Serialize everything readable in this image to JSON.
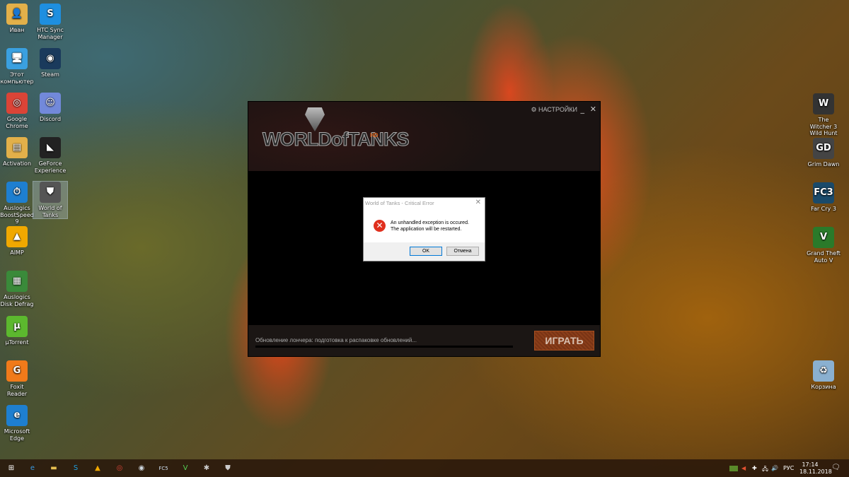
{
  "desktop": {
    "left_icons": [
      {
        "label": "Иван",
        "glyph": "👤",
        "color": "#e2b04a"
      },
      {
        "label": "HTC Sync Manager",
        "glyph": "S",
        "color": "#1e8fe0"
      },
      {
        "label": "Этот компьютер",
        "glyph": "🖥",
        "color": "#3aa0e0"
      },
      {
        "label": "Steam",
        "glyph": "◉",
        "color": "#1a3a5c"
      },
      {
        "label": "Google Chrome",
        "glyph": "◎",
        "color": "#db4437"
      },
      {
        "label": "Discord",
        "glyph": "☺",
        "color": "#7289da"
      },
      {
        "label": "Activation",
        "glyph": "▤",
        "color": "#e2b04a"
      },
      {
        "label": "GeForce Experience",
        "glyph": "◣",
        "color": "#222"
      },
      {
        "label": "Auslogics BoostSpeed 9",
        "glyph": "⏱",
        "color": "#1e7fd0"
      },
      {
        "label": "World of Tanks",
        "glyph": "⛊",
        "color": "#555"
      },
      {
        "label": "AIMP",
        "glyph": "▲",
        "color": "#f0a800"
      },
      {
        "label": "Auslogics Disk Defrag",
        "glyph": "▦",
        "color": "#3a8a3a"
      },
      {
        "label": "µTorrent",
        "glyph": "µ",
        "color": "#5cb82e"
      },
      {
        "label": "Foxit Reader",
        "glyph": "G",
        "color": "#f07a1a"
      },
      {
        "label": "Microsoft Edge",
        "glyph": "e",
        "color": "#1e7fd0"
      }
    ],
    "right_icons": [
      {
        "label": "The Witcher 3 Wild Hunt",
        "glyph": "W",
        "color": "#333"
      },
      {
        "label": "Grim Dawn",
        "glyph": "GD",
        "color": "#444"
      },
      {
        "label": "Far Cry 3",
        "glyph": "FC3",
        "color": "#1a4a6a"
      },
      {
        "label": "Grand Theft Auto V",
        "glyph": "V",
        "color": "#2a7a2a"
      },
      {
        "label": "Корзина",
        "glyph": "♻",
        "color": "#8ab0d0"
      }
    ]
  },
  "launcher": {
    "logo": "WORLDofTANKS",
    "hd": "HD",
    "settings": "⚙ НАСТРОЙКИ",
    "status": "Обновление лончера: подготовка к распаковке обновлений...",
    "play": "ИГРАТЬ",
    "progress": 0
  },
  "dialog": {
    "title": "World of Tanks - Critical Error",
    "line1": "An unhandled exception is occured.",
    "line2": "The application will be restarted.",
    "ok": "OK",
    "cancel": "Отмена"
  },
  "taskbar": {
    "apps": [
      {
        "name": "start",
        "glyph": "⊞",
        "color": "#fff"
      },
      {
        "name": "edge",
        "glyph": "e",
        "color": "#3a9ae0"
      },
      {
        "name": "explorer",
        "glyph": "▬",
        "color": "#e8c050"
      },
      {
        "name": "skype",
        "glyph": "S",
        "color": "#1ea0e0"
      },
      {
        "name": "aimp",
        "glyph": "▲",
        "color": "#f0a800"
      },
      {
        "name": "chrome",
        "glyph": "◎",
        "color": "#db4437"
      },
      {
        "name": "steam",
        "glyph": "◉",
        "color": "#cfd8e0"
      },
      {
        "name": "far-cry-5",
        "glyph": "FC5",
        "color": "#cde"
      },
      {
        "name": "gta-v",
        "glyph": "V",
        "color": "#5c5"
      },
      {
        "name": "spider",
        "glyph": "✱",
        "color": "#ccc"
      },
      {
        "name": "world-of-tanks",
        "glyph": "⛊",
        "color": "#ccc"
      }
    ],
    "lang": "РУС",
    "time": "17:14",
    "date": "18.11.2018"
  }
}
